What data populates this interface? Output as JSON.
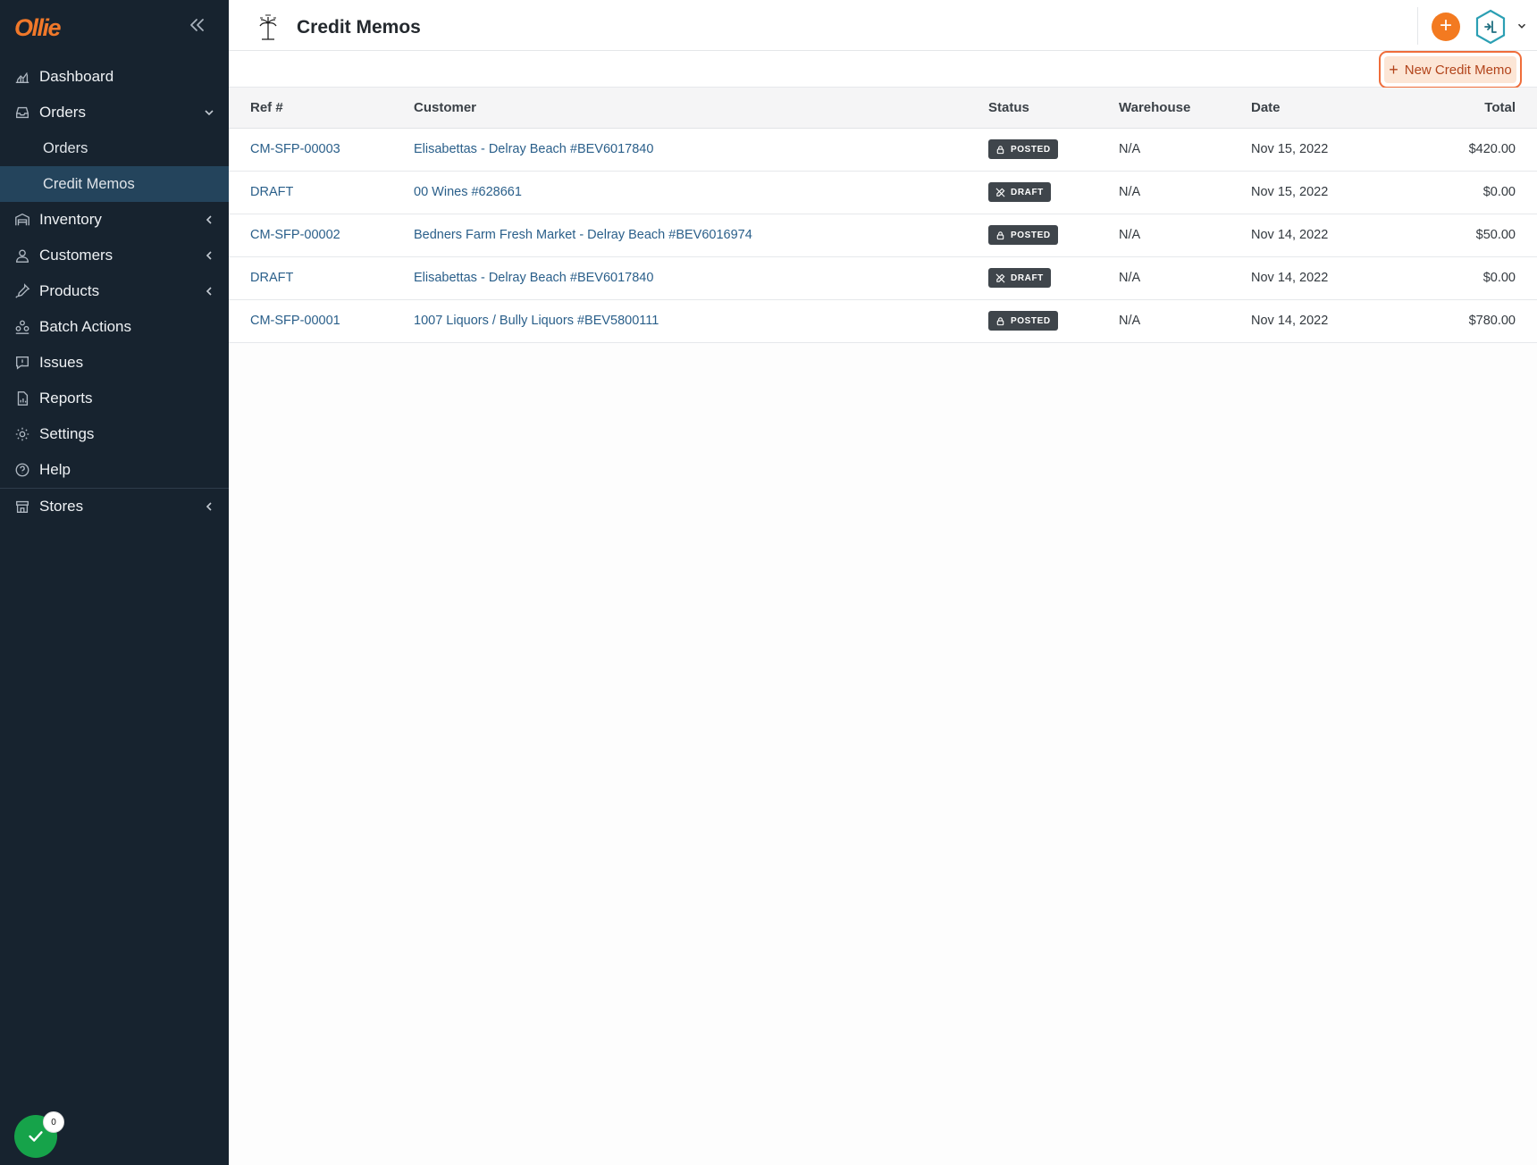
{
  "app": {
    "logo_text": "Ollie"
  },
  "sidebar": {
    "items": [
      {
        "label": "Dashboard"
      },
      {
        "label": "Orders",
        "expanded": true,
        "sub": [
          {
            "label": "Orders"
          },
          {
            "label": "Credit Memos",
            "active": true
          }
        ]
      },
      {
        "label": "Inventory"
      },
      {
        "label": "Customers"
      },
      {
        "label": "Products"
      },
      {
        "label": "Batch Actions"
      },
      {
        "label": "Issues"
      },
      {
        "label": "Reports"
      },
      {
        "label": "Settings"
      },
      {
        "label": "Help"
      },
      {
        "label": "Stores"
      }
    ],
    "status_count": "0"
  },
  "header": {
    "title": "Credit Memos"
  },
  "actions": {
    "new_label": "New Credit Memo"
  },
  "table": {
    "columns": [
      "Ref #",
      "Customer",
      "Status",
      "Warehouse",
      "Date",
      "Total"
    ],
    "rows": [
      {
        "ref": "CM-SFP-00003",
        "customer": "Elisabettas - Delray Beach #BEV6017840",
        "status": "POSTED",
        "warehouse": "N/A",
        "date": "Nov 15, 2022",
        "total": "$420.00"
      },
      {
        "ref": "DRAFT",
        "customer": "00 Wines #628661",
        "status": "DRAFT",
        "warehouse": "N/A",
        "date": "Nov 15, 2022",
        "total": "$0.00"
      },
      {
        "ref": "CM-SFP-00002",
        "customer": "Bedners Farm Fresh Market - Delray Beach #BEV6016974",
        "status": "POSTED",
        "warehouse": "N/A",
        "date": "Nov 14, 2022",
        "total": "$50.00"
      },
      {
        "ref": "DRAFT",
        "customer": "Elisabettas - Delray Beach #BEV6017840",
        "status": "DRAFT",
        "warehouse": "N/A",
        "date": "Nov 14, 2022",
        "total": "$0.00"
      },
      {
        "ref": "CM-SFP-00001",
        "customer": "1007 Liquors / Bully Liquors #BEV5800111",
        "status": "POSTED",
        "warehouse": "N/A",
        "date": "Nov 14, 2022",
        "total": "$780.00"
      }
    ]
  },
  "colors": {
    "sidebar_bg": "#17232f",
    "accent": "#f37a20",
    "link": "#2a5f8a",
    "active_item": "#24445c",
    "success": "#16a34a"
  }
}
